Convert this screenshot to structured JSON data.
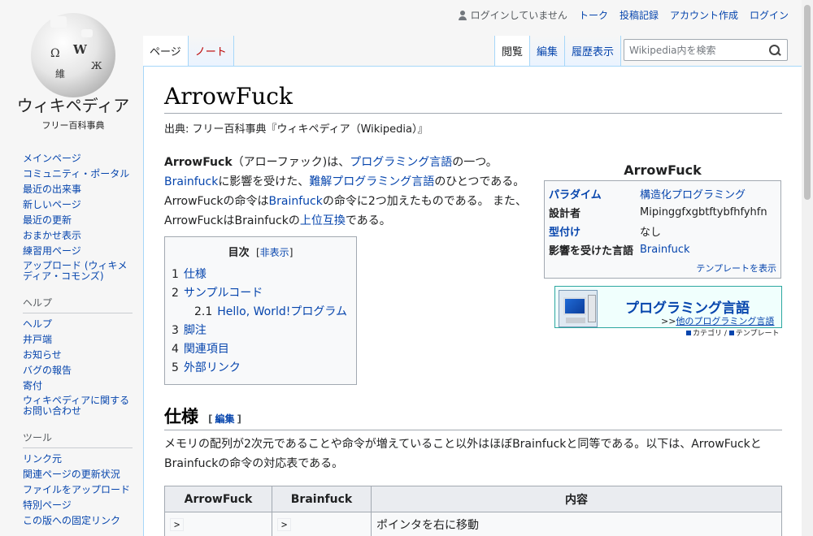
{
  "logo": {
    "wordmark": "ウィキペディア",
    "tagline": "フリー百科事典",
    "globe_glyphs": [
      "Ω",
      "W",
      "維",
      "Ж"
    ]
  },
  "personal": {
    "not_logged_in": "ログインしていません",
    "talk": "トーク",
    "contributions": "投稿記録",
    "create_account": "アカウント作成",
    "login": "ログイン"
  },
  "tabs": {
    "page": "ページ",
    "note": "ノート",
    "read": "閲覧",
    "edit": "編集",
    "history": "履歴表示"
  },
  "search": {
    "placeholder": "Wikipedia内を検索"
  },
  "sidebar": {
    "nav": [
      "メインページ",
      "コミュニティ・ポータル",
      "最近の出来事",
      "新しいページ",
      "最近の更新",
      "おまかせ表示",
      "練習用ページ",
      "アップロード (ウィキメディア・コモンズ)"
    ],
    "help_heading": "ヘルプ",
    "help": [
      "ヘルプ",
      "井戸端",
      "お知らせ",
      "バグの報告",
      "寄付",
      "ウィキペディアに関するお問い合わせ"
    ],
    "tools_heading": "ツール",
    "tools": [
      "リンク元",
      "関連ページの更新状況",
      "ファイルをアップロード",
      "特別ページ",
      "この版への固定リンク"
    ]
  },
  "article": {
    "title": "ArrowFuck",
    "site_sub": "出典: フリー百科事典『ウィキペディア（Wikipedia）』",
    "lead": {
      "bold": "ArrowFuck",
      "t1": "（アローファック)は、",
      "l1": "プログラミング言語",
      "t2": "の一つ。",
      "l2": "Brainfuck",
      "t3": "に影響を受けた、",
      "l3": "難解プログラミング言語",
      "t4": "のひとつである。 ArrowFuckの命令は",
      "l4": "Brainfuck",
      "t5": "の命令に2つ加えたものである。 また、ArrowFuckはBrainfuckの",
      "l5": "上位互換",
      "t6": "である。"
    },
    "toc": {
      "title": "目次",
      "toggle": "非表示",
      "items": [
        {
          "num": "1",
          "label": "仕様"
        },
        {
          "num": "2",
          "label": "サンプルコード"
        },
        {
          "num": "2.1",
          "label": "Hello, World!プログラム"
        },
        {
          "num": "3",
          "label": "脚注"
        },
        {
          "num": "4",
          "label": "関連項目"
        },
        {
          "num": "5",
          "label": "外部リンク"
        }
      ]
    },
    "infobox": {
      "caption": "ArrowFuck",
      "rows": [
        {
          "key": "パラダイム",
          "value": "構造化プログラミング"
        },
        {
          "key": "設計者",
          "value": "Mipinggfxgbtftybfhfyhfn"
        },
        {
          "key": "型付け",
          "value": "なし"
        },
        {
          "key": "影響を受けた言語",
          "value": "Brainfuck"
        }
      ],
      "template_link": "テンプレートを表示"
    },
    "navbox": {
      "title": "プログラミング言語",
      "other_prefix": ">>",
      "other": "他のプログラミング言語",
      "category": "カテゴリ",
      "template": "テンプレート"
    },
    "section": {
      "heading": "仕様",
      "edit": "編集",
      "paragraph": "メモリの配列が2次元であることや命令が増えていること以外はほぼBrainfuckと同等である。以下は、ArrowFuckとBrainfuckの命令の対応表である。"
    },
    "table": {
      "headers": [
        "ArrowFuck",
        "Brainfuck",
        "内容"
      ],
      "rows": [
        {
          "af": ">",
          "bf": ">",
          "desc": "ポインタを右に移動"
        }
      ]
    }
  }
}
